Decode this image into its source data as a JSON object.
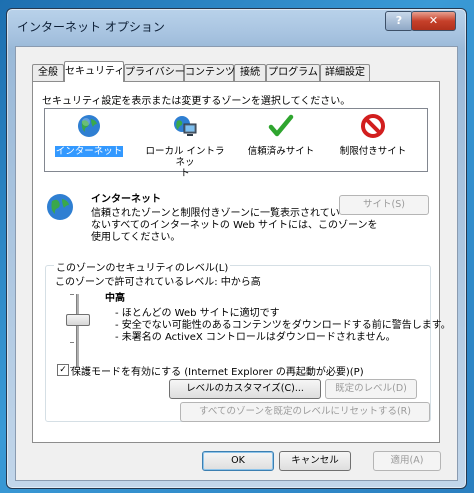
{
  "window": {
    "title": "インターネット オプション",
    "help_label": "?",
    "close_label": "✕"
  },
  "tabs": [
    {
      "label": "全般"
    },
    {
      "label": "セキュリティ",
      "active": true
    },
    {
      "label": "プライバシー"
    },
    {
      "label": "コンテンツ"
    },
    {
      "label": "接続"
    },
    {
      "label": "プログラム"
    },
    {
      "label": "詳細設定"
    }
  ],
  "security": {
    "instruction": "セキュリティ設定を表示または変更するゾーンを選択してください。",
    "zones": [
      {
        "label": "インターネット",
        "icon": "globe-icon",
        "selected": true
      },
      {
        "label_line1": "ローカル イントラネッ",
        "label_line2": "ト",
        "icon": "intranet-icon"
      },
      {
        "label": "信頼済みサイト",
        "icon": "checkmark-icon"
      },
      {
        "label": "制限付きサイト",
        "icon": "restricted-icon"
      }
    ],
    "zone_title": "インターネット",
    "zone_desc_1": "信頼されたゾーンと制限付きゾーンに一覧表示されてい",
    "zone_desc_2": "ないすべてのインターネットの Web サイトには、このゾーンを",
    "zone_desc_3": "使用してください。",
    "sites_button": "サイト(S)",
    "level_group": "このゾーンのセキュリティのレベル(L)",
    "allowed_levels": "このゾーンで許可されているレベル: 中から高",
    "level_name": "中高",
    "level_desc_1": "- ほとんどの Web サイトに適切です",
    "level_desc_2": "- 安全でない可能性のあるコンテンツをダウンロードする前に警告します。",
    "level_desc_3": "- 未署名の ActiveX コントロールはダウンロードされません。",
    "protected_mode": "保護モードを有効にする (Internet Explorer の再起動が必要)(P)",
    "protected_mode_checked": true,
    "custom_level": "レベルのカスタマイズ(C)...",
    "default_level": "既定のレベル(D)",
    "reset_all": "すべてのゾーンを既定のレベルにリセットする(R)"
  },
  "footer": {
    "ok": "OK",
    "cancel": "キャンセル",
    "apply": "適用(A)"
  },
  "colors": {
    "selection": "#3399ff",
    "check_green": "#2fa52f",
    "restricted_red": "#d21e1e"
  }
}
